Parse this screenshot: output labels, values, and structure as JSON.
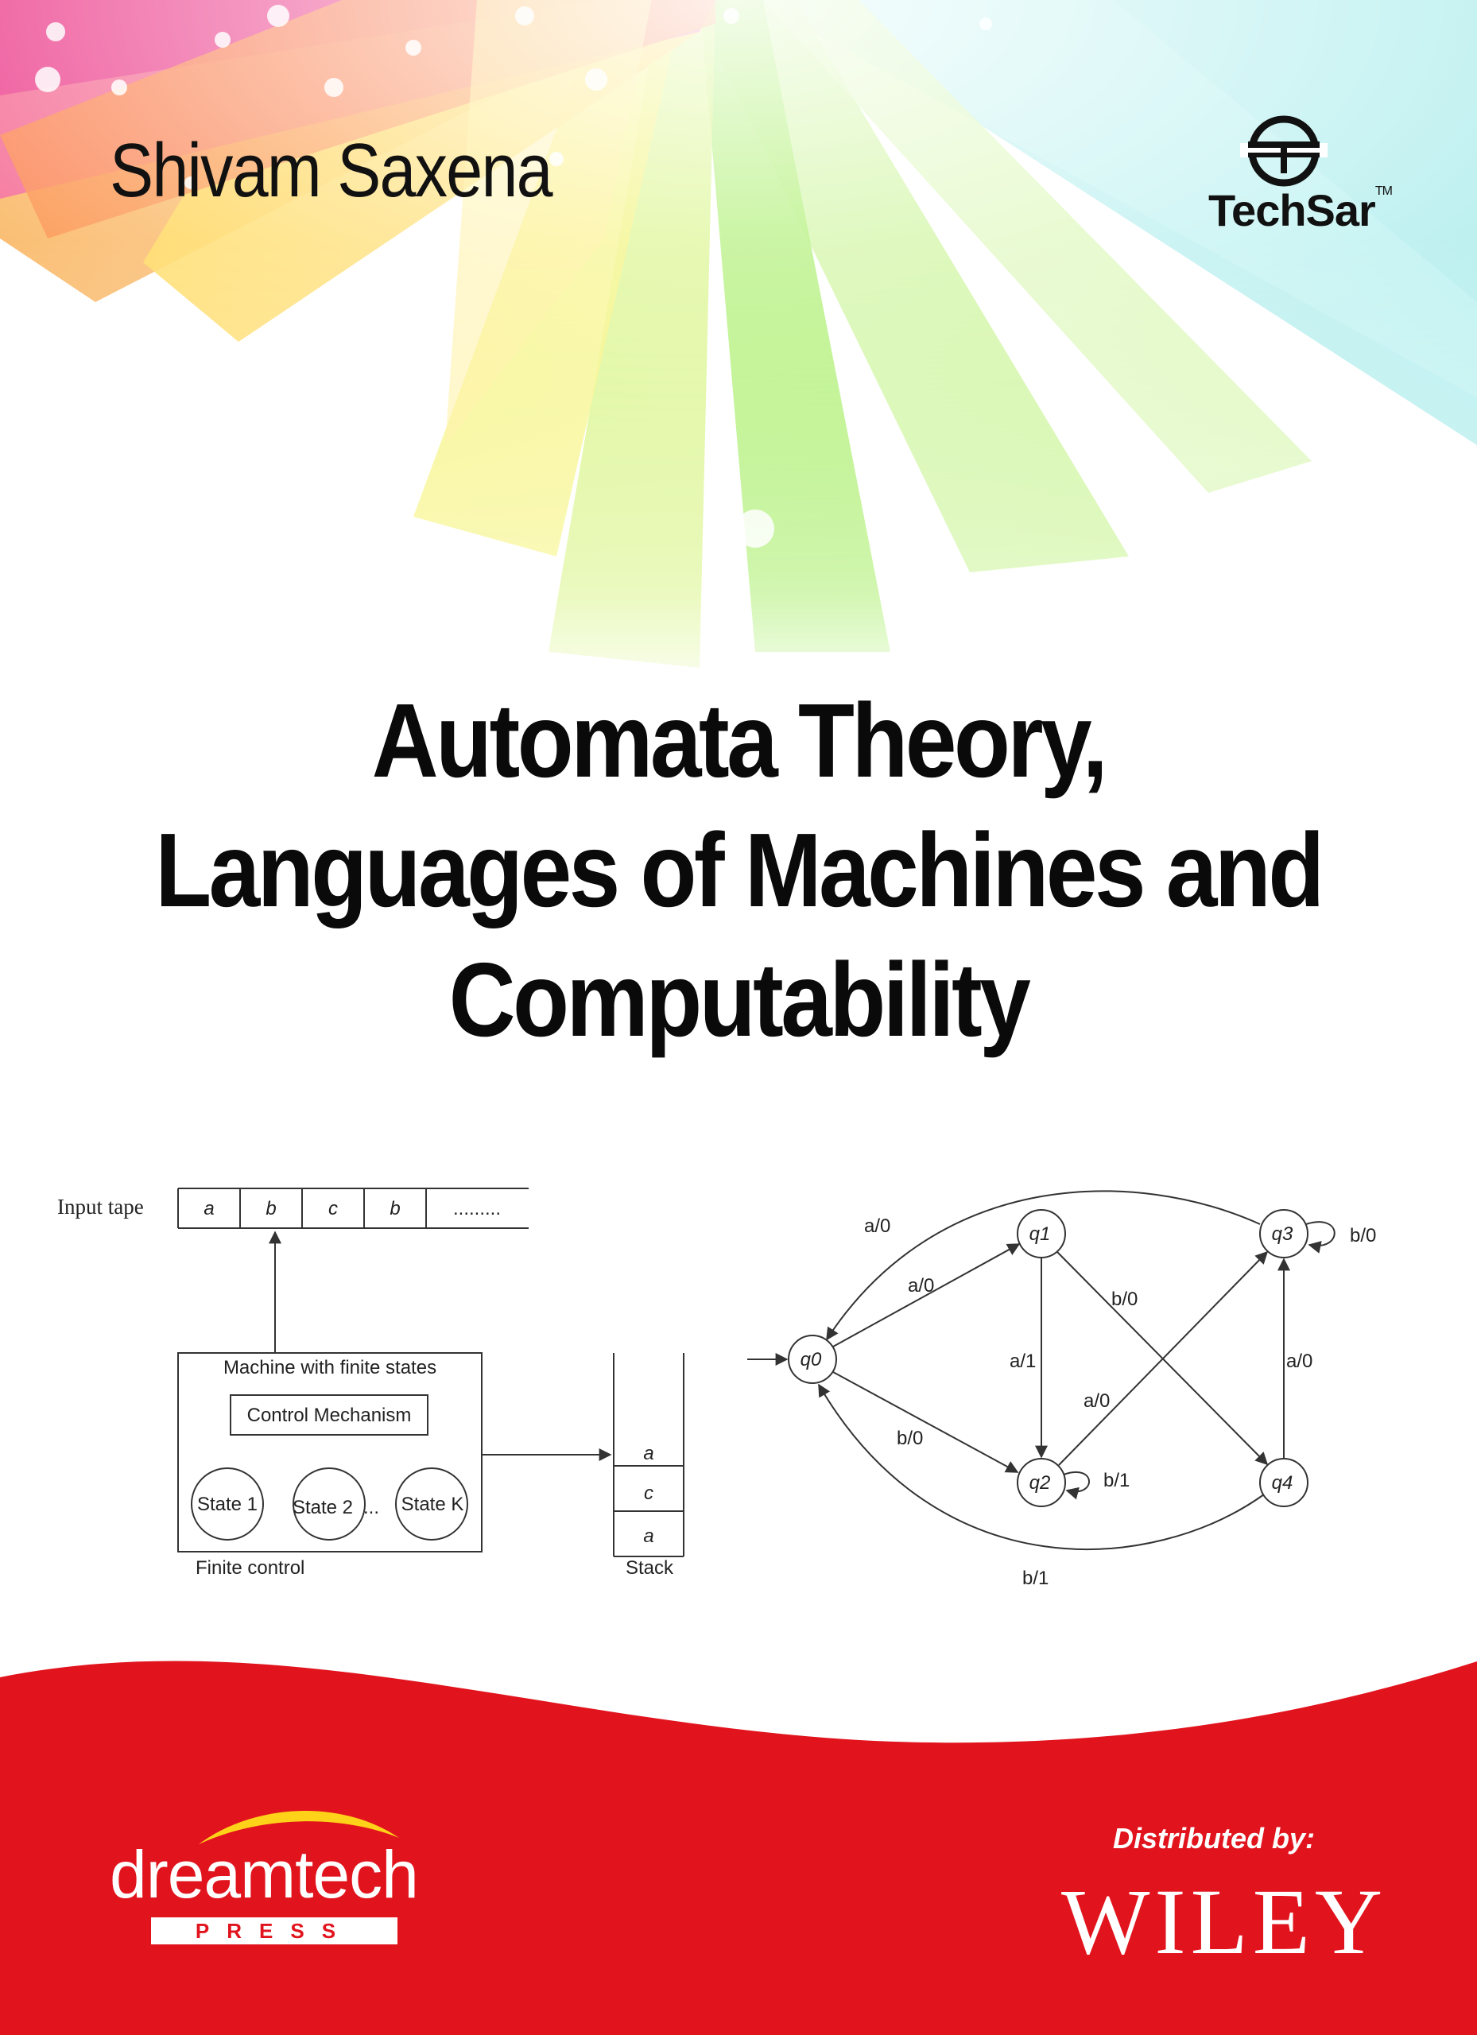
{
  "cover": {
    "author": "Shivam Saxena",
    "series_logo": {
      "text": "TechSar",
      "trademark": "TM",
      "icon": "techsar-monogram-icon"
    },
    "title_lines": [
      "Automata Theory,",
      "Languages of Machines and",
      "Computability"
    ],
    "distributed_by": "Distributed by:",
    "publisher": "dreamtech",
    "publisher_sub": "PRESS",
    "distributor": "WILEY",
    "colors": {
      "footer_red": "#e1141e",
      "title": "#0a0a0a"
    }
  },
  "pda_diagram": {
    "input_tape_label": "Input tape",
    "tape_cells": [
      "a",
      "b",
      "c",
      "b",
      "........."
    ],
    "machine_label": "Machine with finite states",
    "control_label": "Control Mechanism",
    "states": [
      "State 1",
      "State 2",
      "State K"
    ],
    "ellipsis": "...",
    "finite_control_label": "Finite control",
    "stack_cells": [
      "a",
      "c",
      "a"
    ],
    "stack_label": "Stack"
  },
  "state_diagram": {
    "states": [
      "q0",
      "q1",
      "q2",
      "q3",
      "q4"
    ],
    "edge_labels": {
      "q0_q1": "a/0",
      "q0_q2": "b/0",
      "q1_q2": "a/1",
      "q1_q4": "b/0",
      "q2_q2": "b/1",
      "q2_q3": "a/0",
      "q3_q0": "a/0",
      "q3_q3": "b/0",
      "q4_q3": "a/0",
      "q4_q0": "b/1"
    }
  }
}
